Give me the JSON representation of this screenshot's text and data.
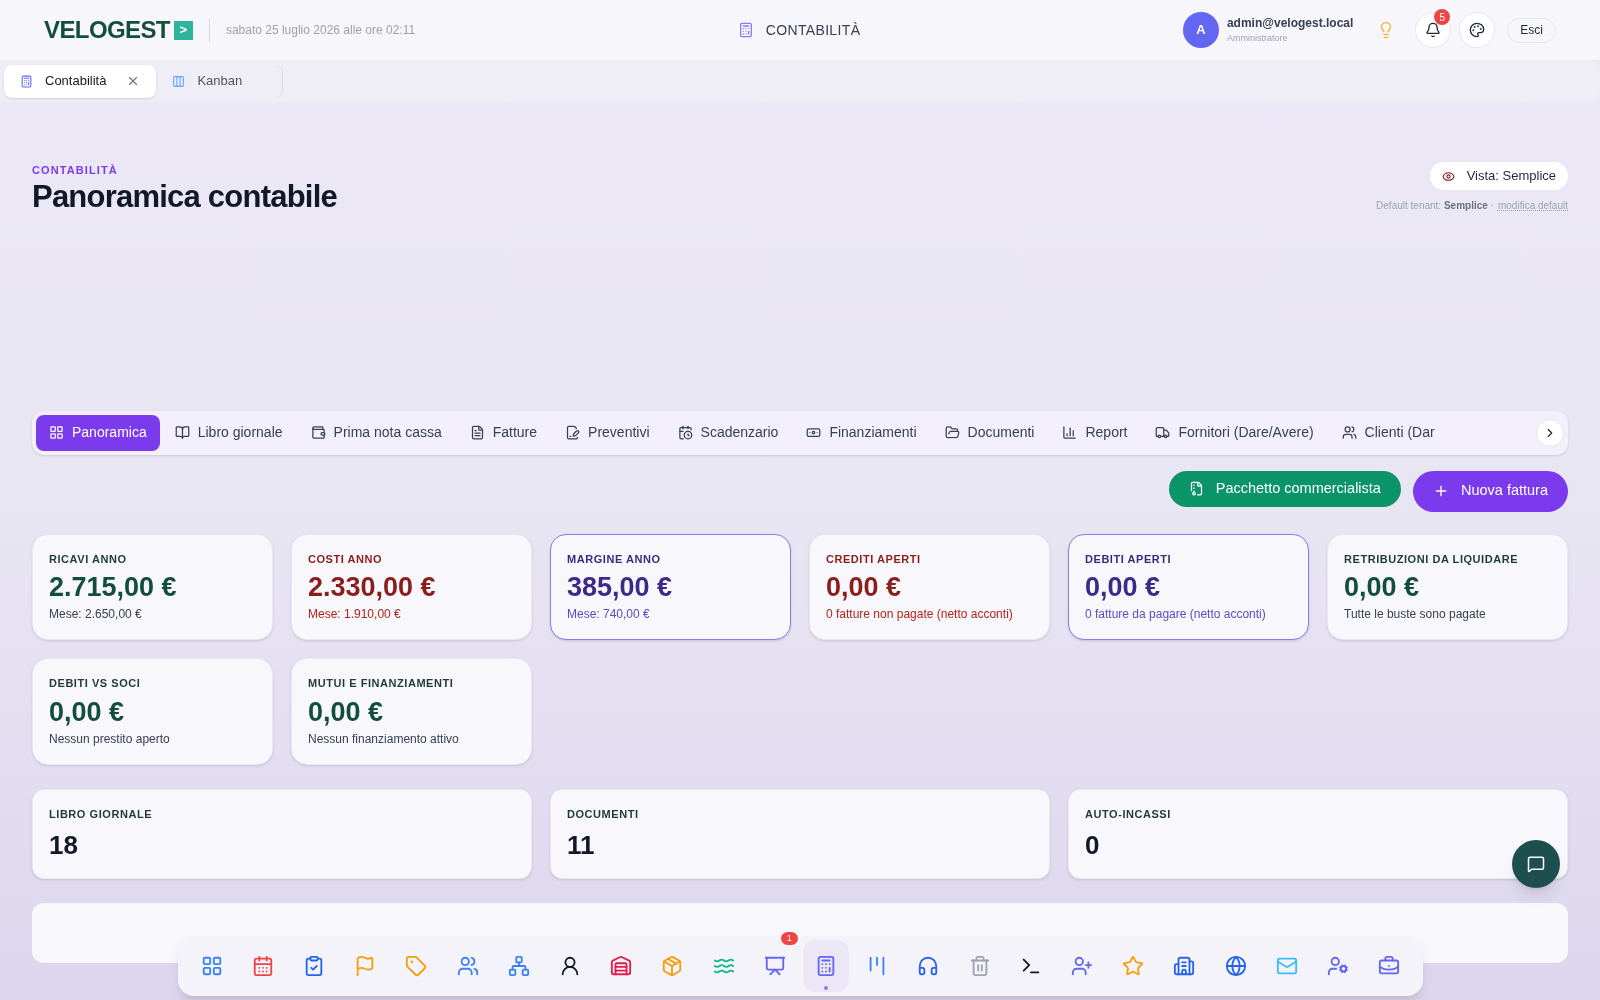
{
  "header": {
    "logo": "VELOGEST",
    "logo_mark": ">",
    "datetime": "sabato 25 luglio 2026 alle ore 02:11",
    "section": "CONTABILITÀ",
    "user": {
      "initial": "A",
      "email": "admin@velogest.local",
      "role": "Amministratore"
    },
    "notifications": "5",
    "logout": "Esci"
  },
  "open_tabs": [
    {
      "label": "Contabilità",
      "selected": true,
      "closable": true
    },
    {
      "label": "Kanban",
      "selected": false,
      "closable": false
    }
  ],
  "page": {
    "eyebrow": "CONTABILITÀ",
    "title": "Panoramica contabile",
    "view_button": "Vista: Semplice",
    "default_label": "Default tenant:",
    "default_value": "Semplice",
    "default_sep": "·",
    "default_link": "modifica default"
  },
  "tabs": [
    {
      "label": "Panoramica",
      "selected": true
    },
    {
      "label": "Libro giornale",
      "selected": false
    },
    {
      "label": "Prima nota cassa",
      "selected": false
    },
    {
      "label": "Fatture",
      "selected": false
    },
    {
      "label": "Preventivi",
      "selected": false
    },
    {
      "label": "Scadenzario",
      "selected": false
    },
    {
      "label": "Finanziamenti",
      "selected": false
    },
    {
      "label": "Documenti",
      "selected": false
    },
    {
      "label": "Report",
      "selected": false
    },
    {
      "label": "Fornitori (Dare/Avere)",
      "selected": false
    },
    {
      "label": "Clienti (Dar",
      "selected": false
    }
  ],
  "actions": [
    {
      "label": "Pacchetto commercialista",
      "kind": "secondary"
    },
    {
      "label": "Nuova fattura",
      "kind": "primary"
    }
  ],
  "kpis": [
    {
      "label": "RICAVI ANNO",
      "value": "2.715,00 €",
      "note": "Mese: 2.650,00 €",
      "kind": "green",
      "highlighted": false
    },
    {
      "label": "COSTI ANNO",
      "value": "2.330,00 €",
      "note": "Mese: 1.910,00 €",
      "kind": "red",
      "highlighted": false
    },
    {
      "label": "MARGINE ANNO",
      "value": "385,00 €",
      "note": "Mese: 740,00 €",
      "kind": "indigo",
      "highlighted": true
    },
    {
      "label": "CREDITI APERTI",
      "value": "0,00 €",
      "note": "0 fatture non pagate (netto acconti)",
      "kind": "red",
      "highlighted": false
    },
    {
      "label": "DEBITI APERTI",
      "value": "0,00 €",
      "note": "0 fatture da pagare (netto acconti)",
      "kind": "indigo",
      "highlighted": true
    },
    {
      "label": "RETRIBUZIONI DA LIQUIDARE",
      "value": "0,00 €",
      "note": "Tutte le buste sono pagate",
      "kind": "green",
      "highlighted": false
    },
    {
      "label": "DEBITI VS SOCI",
      "value": "0,00 €",
      "note": "Nessun prestito aperto",
      "kind": "green",
      "highlighted": false
    },
    {
      "label": "MUTUI E FINANZIAMENTI",
      "value": "0,00 €",
      "note": "Nessun finanziamento attivo",
      "kind": "green",
      "highlighted": false
    }
  ],
  "counters": [
    {
      "label": "LIBRO GIORNALE",
      "value": "18"
    },
    {
      "label": "DOCUMENTI",
      "value": "11"
    },
    {
      "label": "AUTO-INCASSI",
      "value": "0"
    }
  ],
  "dock": [
    {
      "selected": false
    },
    {
      "selected": false
    },
    {
      "selected": false
    },
    {
      "selected": false
    },
    {
      "selected": false
    },
    {
      "selected": false
    },
    {
      "selected": false
    },
    {
      "selected": false
    },
    {
      "selected": false
    },
    {
      "selected": false
    },
    {
      "selected": false
    },
    {
      "selected": false,
      "badge": "1"
    },
    {
      "selected": true
    },
    {
      "selected": false
    },
    {
      "selected": false
    },
    {
      "selected": false
    },
    {
      "selected": false
    },
    {
      "selected": false
    },
    {
      "selected": false
    },
    {
      "selected": false
    },
    {
      "selected": false
    },
    {
      "selected": false
    },
    {
      "selected": false
    },
    {
      "selected": false
    }
  ]
}
